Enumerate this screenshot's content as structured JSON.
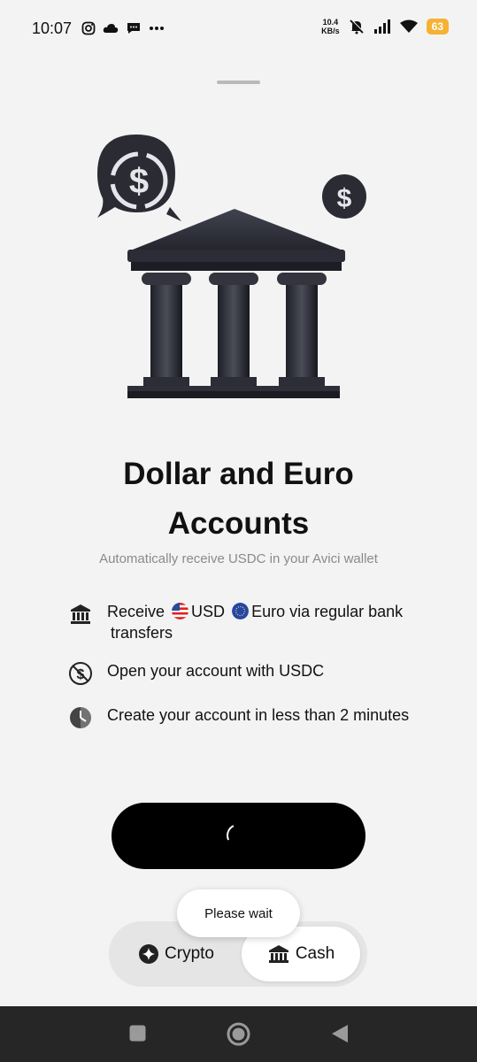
{
  "status_bar": {
    "time": "10:07",
    "speed_value": "10.4",
    "speed_unit": "KB/s",
    "battery": "63"
  },
  "hero": {
    "main_icon": "bank-building-icon",
    "coin_icons": [
      "usdc-coin-icon",
      "dollar-coin-icon"
    ]
  },
  "title": {
    "line1": "Dollar and Euro",
    "line2": "Accounts"
  },
  "subtitle": "Automatically receive USDC in your Avici wallet",
  "features": {
    "bank": {
      "prefix": "Receive",
      "usd": "USD",
      "euro": "Euro via regular bank",
      "cont": "transfers"
    },
    "open": "Open your account with USDC",
    "time": "Create your account in less than 2 minutes"
  },
  "toast": "Please wait",
  "toggle": {
    "crypto": "Crypto",
    "cash": "Cash",
    "selected": "Cash"
  },
  "colors": {
    "background": "#f3f3f3",
    "cta": "#000000",
    "battery": "#f5b233"
  }
}
